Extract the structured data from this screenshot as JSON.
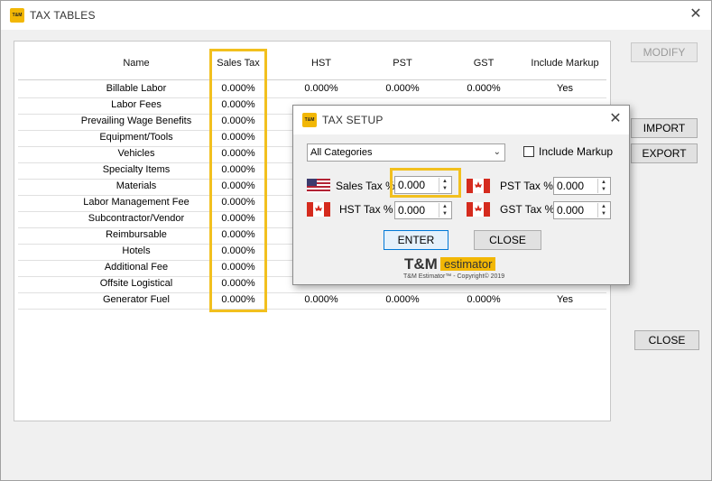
{
  "window": {
    "title": "TAX TABLES",
    "icon_text": "T&M"
  },
  "grid": {
    "headers": [
      "Name",
      "Sales Tax",
      "HST",
      "PST",
      "GST",
      "Include Markup"
    ],
    "rows": [
      {
        "name": "Billable Labor",
        "sales": "0.000%",
        "hst": "0.000%",
        "pst": "0.000%",
        "gst": "0.000%",
        "markup": "Yes"
      },
      {
        "name": "Labor Fees",
        "sales": "0.000%",
        "hst": "",
        "pst": "",
        "gst": "",
        "markup": ""
      },
      {
        "name": "Prevailing Wage Benefits",
        "sales": "0.000%",
        "hst": "",
        "pst": "",
        "gst": "",
        "markup": ""
      },
      {
        "name": "Equipment/Tools",
        "sales": "0.000%",
        "hst": "",
        "pst": "",
        "gst": "",
        "markup": ""
      },
      {
        "name": "Vehicles",
        "sales": "0.000%",
        "hst": "",
        "pst": "",
        "gst": "",
        "markup": ""
      },
      {
        "name": "Specialty Items",
        "sales": "0.000%",
        "hst": "",
        "pst": "",
        "gst": "",
        "markup": ""
      },
      {
        "name": "Materials",
        "sales": "0.000%",
        "hst": "",
        "pst": "",
        "gst": "",
        "markup": ""
      },
      {
        "name": "Labor Management Fee",
        "sales": "0.000%",
        "hst": "",
        "pst": "",
        "gst": "",
        "markup": ""
      },
      {
        "name": "Subcontractor/Vendor",
        "sales": "0.000%",
        "hst": "",
        "pst": "",
        "gst": "",
        "markup": ""
      },
      {
        "name": "Reimbursable",
        "sales": "0.000%",
        "hst": "",
        "pst": "",
        "gst": "",
        "markup": ""
      },
      {
        "name": "Hotels",
        "sales": "0.000%",
        "hst": "",
        "pst": "",
        "gst": "",
        "markup": ""
      },
      {
        "name": "Additional Fee",
        "sales": "0.000%",
        "hst": "",
        "pst": "",
        "gst": "",
        "markup": ""
      },
      {
        "name": "Offsite Logistical",
        "sales": "0.000%",
        "hst": "",
        "pst": "",
        "gst": "",
        "markup": ""
      },
      {
        "name": "Generator Fuel",
        "sales": "0.000%",
        "hst": "0.000%",
        "pst": "0.000%",
        "gst": "0.000%",
        "markup": "Yes"
      }
    ]
  },
  "buttons": {
    "modify": "MODIFY",
    "import": "IMPORT",
    "export": "EXPORT",
    "close": "CLOSE"
  },
  "dialog": {
    "title": "TAX SETUP",
    "icon_text": "T&M",
    "category": "All Categories",
    "include_markup": "Include Markup",
    "sales_tax_label": "Sales Tax %",
    "sales_tax_value": "0.000",
    "hst_label": "HST Tax %",
    "hst_value": "0.000",
    "pst_label": "PST Tax %",
    "pst_value": "0.000",
    "gst_label": "GST Tax %",
    "gst_value": "0.000",
    "enter": "ENTER",
    "close": "CLOSE",
    "logo_tm": "T&M",
    "logo_estimator": "estimator",
    "copyright": "T&M Estimator™ - Copyright© 2019"
  },
  "colors": {
    "highlight": "#f2c01e",
    "brand": "#f2b705"
  }
}
